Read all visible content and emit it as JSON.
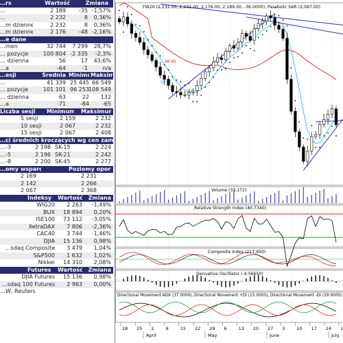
{
  "stats": {
    "header": [
      "…rs",
      "Wartość",
      "Zmiana"
    ],
    "rows": [
      [
        "…",
        "2 189",
        "-35",
        "-1,57%"
      ],
      [
        "…",
        "2 232",
        "8",
        "0,36%"
      ],
      [
        "…m dzienne",
        "2 232",
        "8",
        "0,36%"
      ],
      [
        "…m dzienne",
        "2 176",
        "-48",
        "-2,16%"
      ]
    ]
  },
  "volume": {
    "header": "…e dane",
    "rows": [
      [
        "…men",
        "32 744",
        "7 299",
        "28,7%"
      ],
      [
        "… pozycje",
        "100 804",
        "-2 335",
        "-2,3%"
      ],
      [
        "… dzienna",
        "56",
        "17",
        "43,6%"
      ],
      [
        "…a",
        "-64",
        "-1",
        "n/a"
      ]
    ]
  },
  "sessions": {
    "header": [
      "…esji",
      "Średnia",
      "Minimum",
      "Maksimum"
    ],
    "rows": [
      [
        "…",
        "41 339",
        "25 445",
        "66 549"
      ],
      [
        "… pozycje",
        "101 101",
        "96 253",
        "108 549"
      ],
      [
        "… dzienna",
        "63",
        "22",
        "132"
      ],
      [
        "…a",
        "-71",
        "-84",
        "-65"
      ]
    ]
  },
  "ranges": {
    "header": [
      "Liczba sesji",
      "Minimum",
      "Maksimum"
    ],
    "rows": [
      [
        "5 sesji",
        "2 159",
        "2 232"
      ],
      [
        "10 sesji",
        "2 067",
        "2 232"
      ],
      [
        "15 sesji",
        "2 067",
        "2 408"
      ]
    ]
  },
  "ma": {
    "header": "…ci średnich kroczących wg cen zamknięcia",
    "rows": [
      [
        "…-3",
        "2 198",
        "SK-15",
        "2 224"
      ],
      [
        "…-5",
        "2 196",
        "SK-21",
        "2 242"
      ],
      [
        "…-8",
        "2 200",
        "SK-45",
        "2 277"
      ]
    ]
  },
  "levels": {
    "header": [
      "…omy wsparcia",
      "Poziomy oporu"
    ],
    "rows": [
      [
        "2 169",
        "2 231"
      ],
      [
        "2 142",
        "2 266"
      ],
      [
        "2 067",
        "2 368"
      ]
    ]
  },
  "indices": {
    "header": [
      "Indeksy",
      "Wartość",
      "Zmiana"
    ],
    "rows": [
      [
        "WIG20",
        "2 263",
        "-1,49%"
      ],
      [
        "BUX",
        "18 894",
        "0,20%"
      ],
      [
        "ISE100",
        "73 112",
        "-3,05%"
      ],
      [
        "XetraDAX",
        "7 806",
        "-2,36%"
      ],
      [
        "CAC40",
        "3 744",
        "-1,46%"
      ],
      [
        "DJIA",
        "15 136",
        "0,98%"
      ],
      [
        "…sdaq Composite",
        "3 479",
        "1,04%"
      ],
      [
        "S&P500",
        "1 632",
        "1,02%"
      ],
      [
        "Nikkei",
        "14 310",
        "2,08%"
      ]
    ]
  },
  "futures": {
    "header": [
      "Futures",
      "Wartość",
      "Zmiana"
    ],
    "rows": [
      [
        "DJIA Futures",
        "15 136",
        "0,98%"
      ],
      [
        "…sdaq 100 Futures",
        "2 963",
        "0,00%"
      ]
    ]
  },
  "source": "…W, Reuters",
  "colors": {
    "header": "#2a2a6c",
    "row_alt": "#ececec",
    "sk45": "#b03020",
    "sk15": "#30c0e0",
    "trend": "#4040cc",
    "sar": "#000000",
    "volume": "#4040cc",
    "rsi": "#000000",
    "ref_red": "#e02020",
    "ref_green": "#20a040",
    "composite": "#e03030",
    "adx": "#000000",
    "dip": "#20a040",
    "dim": "#e03030",
    "grid": "#c8c8c8"
  },
  "chart": {
    "title": "FW20 (2,232.00, 2,232.00, 2,176.00, 2,189.00, -36.0000), Parabolic SAR (2,067.00)",
    "label_sk45": "SK-45",
    "label_sk15": "SK-15",
    "volume_title": "Volume (33,172)",
    "rsi_title": "Relative Strength Index (40.7340)",
    "composite_title": "Composite Index (217.950)",
    "derivative_title": "Derivative Oscillator (-4.56650)",
    "dmi_title": "Directional Movement ADX (37.0000), Directional Movement +DI (15.0000), Directional Movement -DI (29.0000)",
    "day_labels": [
      "18",
      "25",
      "2",
      "8",
      "15",
      "22",
      "29",
      "6",
      "13",
      "20",
      "27",
      "3",
      "10",
      "17",
      "24",
      "1"
    ],
    "month_labels": [
      "April",
      "May",
      "June",
      "July"
    ]
  },
  "chart_data": {
    "type": "candlestick",
    "instrument": "FW20",
    "ohlc_last": [
      2232,
      2232,
      2176,
      2189
    ],
    "change": -36,
    "parabolic_sar": 2067,
    "closes": [
      2440,
      2452,
      2435,
      2412,
      2402,
      2390,
      2372,
      2360,
      2346,
      2330,
      2310,
      2300,
      2285,
      2270,
      2268,
      2262,
      2262,
      2268,
      2272,
      2285,
      2302,
      2318,
      2328,
      2342,
      2352,
      2348,
      2368,
      2382,
      2376,
      2390,
      2412,
      2405,
      2395,
      2424,
      2436,
      2442,
      2455,
      2450,
      2432,
      2422,
      2400,
      2300,
      2222,
      2172,
      2135,
      2100,
      2125,
      2160,
      2165,
      2190,
      2202,
      2215,
      2228,
      2189
    ],
    "volume_last": 33172,
    "rsi": 40.734,
    "composite": 217.95,
    "derivative_oscillator": -4.5665,
    "adx": 37,
    "plus_di": 15,
    "minus_di": 29
  }
}
